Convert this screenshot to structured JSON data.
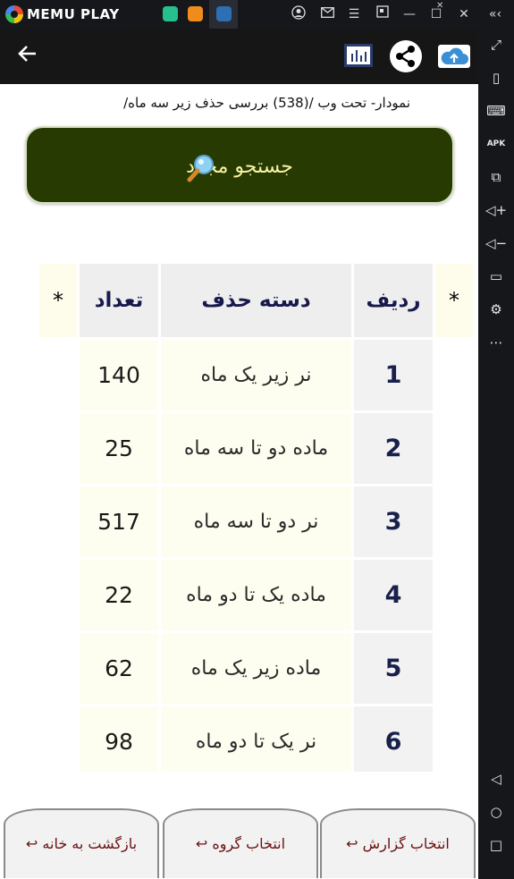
{
  "emulator": {
    "brand": "MEMU PLAY",
    "window_controls": [
      "account-icon",
      "mail-icon",
      "menu-icon",
      "screenshot-icon",
      "minimize-icon",
      "maximize-icon",
      "close-icon",
      "collapse-icon"
    ],
    "sidebar_icons": [
      "fullscreen-icon",
      "rotate-icon",
      "keyboard-icon",
      "apk-icon",
      "multi-window-icon",
      "volume-up-icon",
      "volume-down-icon",
      "folder-icon",
      "settings-icon",
      "more-icon",
      "android-back-icon",
      "android-home-icon",
      "android-recents-icon"
    ]
  },
  "appbar": {
    "back_icon": "arrow-back-icon",
    "actions": [
      "chart-icon",
      "share-icon",
      "cloud-upload-icon"
    ]
  },
  "subtitle": "نمودار- تحت وب /(538) بررسی حذف زیر سه ماه/",
  "search_button": {
    "label": "جستجو مجدد"
  },
  "table": {
    "headers": {
      "star_left": "*",
      "count": "تعداد",
      "category": "دسته حذف",
      "row": "ردیف",
      "star_right": "*"
    },
    "rows": [
      {
        "row": "1",
        "category": "نر زیر یک ماه",
        "count": "140"
      },
      {
        "row": "2",
        "category": "ماده دو تا سه ماه",
        "count": "25"
      },
      {
        "row": "3",
        "category": "نر دو تا سه ماه",
        "count": "517"
      },
      {
        "row": "4",
        "category": "ماده یک تا دو ماه",
        "count": "22"
      },
      {
        "row": "5",
        "category": "ماده زیر یک ماه",
        "count": "62"
      },
      {
        "row": "6",
        "category": "نر یک تا دو ماه",
        "count": "98"
      }
    ]
  },
  "bottom_tabs": [
    {
      "label": "بازگشت به خانه",
      "arrow": "↩"
    },
    {
      "label": "انتخاب گروه",
      "arrow": "↩"
    },
    {
      "label": "انتخاب گزارش",
      "arrow": "↩"
    }
  ],
  "colors": {
    "search_bg": "#263a02",
    "search_text": "#f8f3a4",
    "header_text": "#17194d",
    "tab_text": "#6a1010"
  }
}
